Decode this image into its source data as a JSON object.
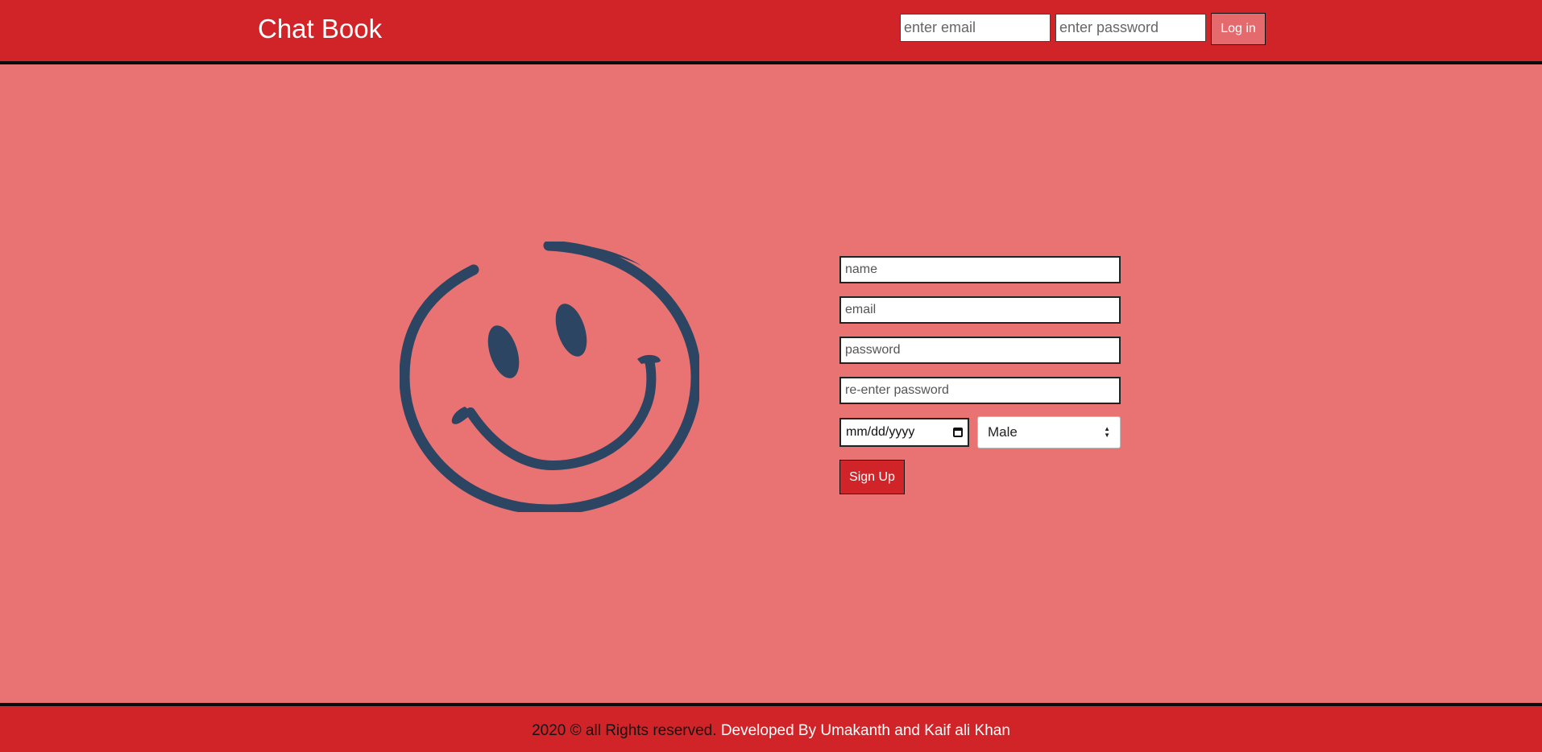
{
  "header": {
    "title": "Chat Book",
    "login": {
      "email_placeholder": "enter email",
      "password_placeholder": "enter password",
      "button_label": "Log in"
    }
  },
  "logo": {
    "icon": "smiley-face-icon",
    "color": "#2c4562"
  },
  "signup": {
    "name_placeholder": "name",
    "email_placeholder": "email",
    "password_placeholder": "password",
    "reenter_placeholder": "re-enter password",
    "date_placeholder": "mm/dd/yyyy",
    "gender_selected": "Male",
    "button_label": "Sign Up"
  },
  "footer": {
    "copyright": "2020 © all Rights reserved.",
    "credits": "Developed By Umakanth and Kaif ali Khan"
  },
  "colors": {
    "header_bg": "#d12428",
    "page_bg": "#e97373",
    "accent": "#2c4562"
  }
}
